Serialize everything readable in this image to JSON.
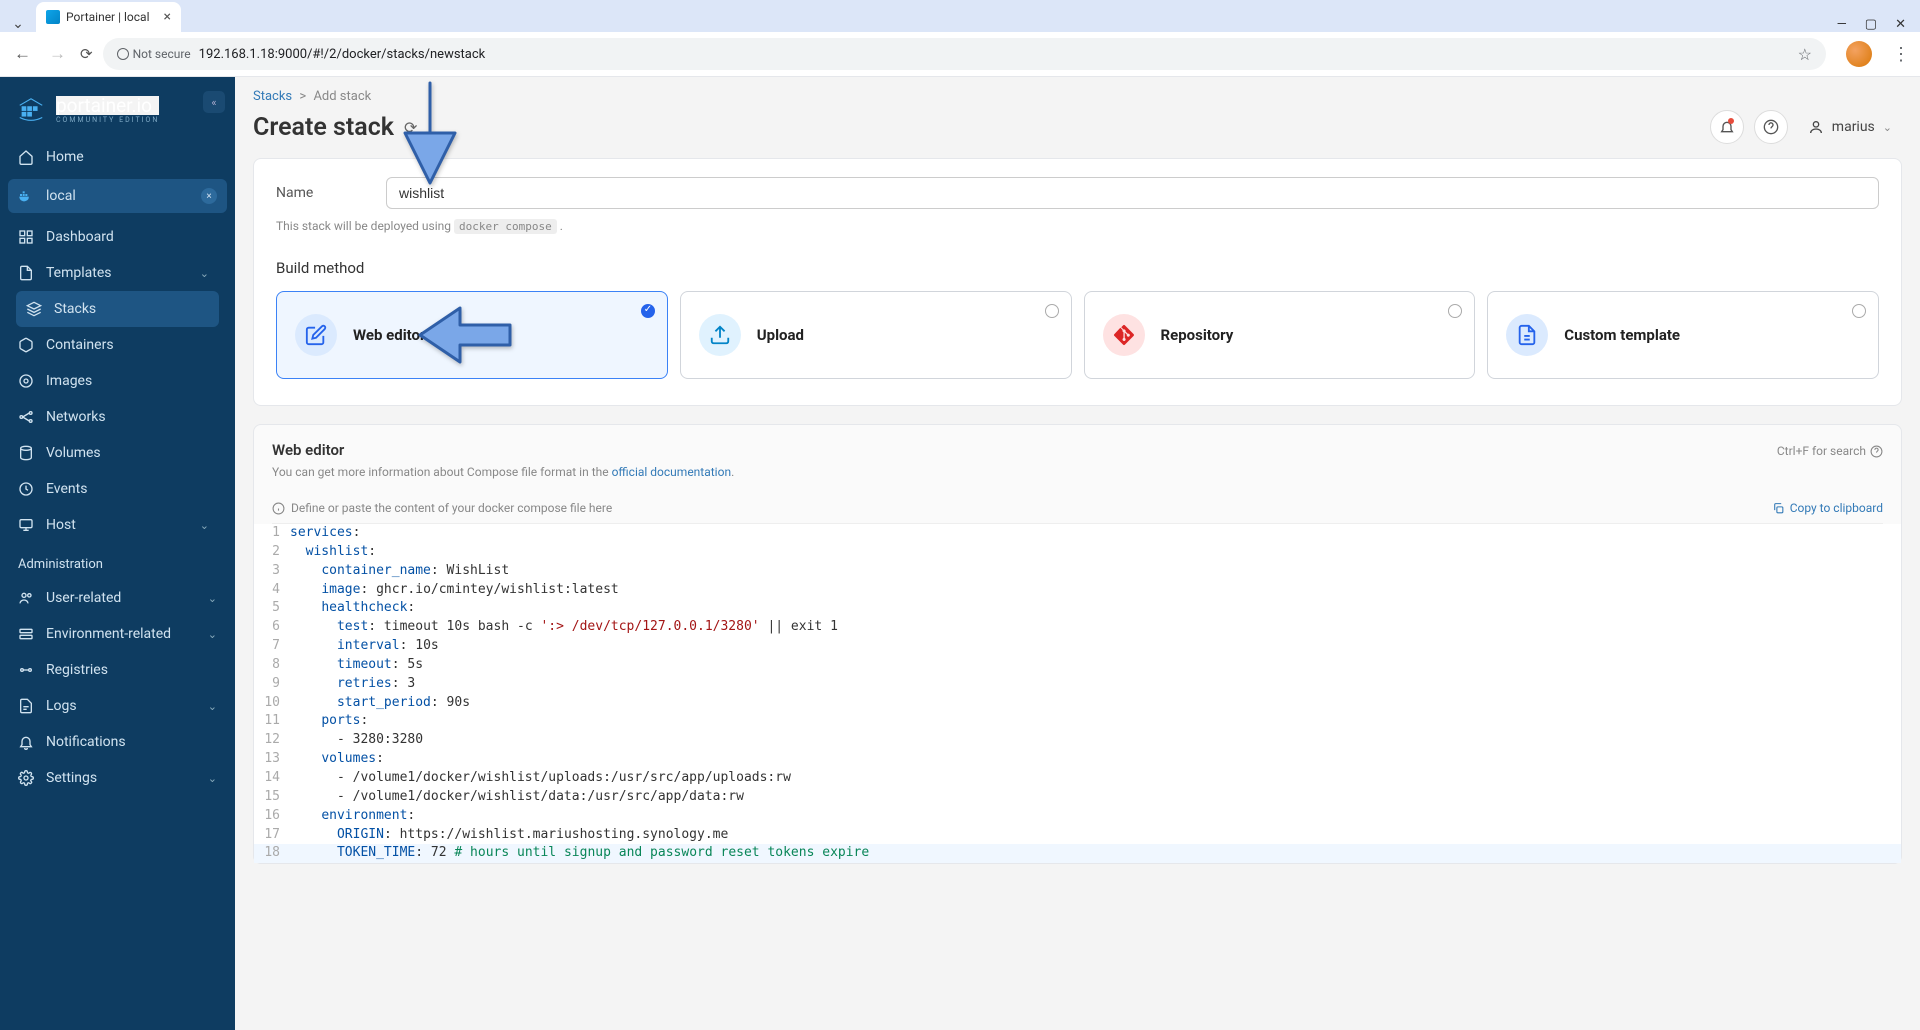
{
  "browser": {
    "tab_title": "Portainer | local",
    "url": "192.168.1.18:9000/#!/2/docker/stacks/newstack",
    "security_label": "Not secure"
  },
  "sidebar": {
    "brand": "portainer.io",
    "brand_sub": "COMMUNITY EDITION",
    "home": "Home",
    "env_name": "local",
    "items": {
      "dashboard": "Dashboard",
      "templates": "Templates",
      "stacks": "Stacks",
      "containers": "Containers",
      "images": "Images",
      "networks": "Networks",
      "volumes": "Volumes",
      "events": "Events",
      "host": "Host"
    },
    "admin_heading": "Administration",
    "admin": {
      "user_related": "User-related",
      "env_related": "Environment-related",
      "registries": "Registries",
      "logs": "Logs",
      "notifications": "Notifications",
      "settings": "Settings"
    }
  },
  "header": {
    "breadcrumb_root": "Stacks",
    "breadcrumb_sep": ">",
    "breadcrumb_leaf": "Add stack",
    "title": "Create stack",
    "username": "marius"
  },
  "form": {
    "name_label": "Name",
    "name_value": "wishlist",
    "helper_prefix": "This stack will be deployed using ",
    "helper_code": "docker compose",
    "build_method_label": "Build method",
    "methods": {
      "web_editor": "Web editor",
      "upload": "Upload",
      "repository": "Repository",
      "custom": "Custom template"
    }
  },
  "editor": {
    "title": "Web editor",
    "search_hint": "Ctrl+F for search",
    "sub_prefix": "You can get more information about Compose file format in the ",
    "sub_link": "official documentation",
    "placeholder_hint": "Define or paste the content of your docker compose file here",
    "copy_label": "Copy to clipboard",
    "code_lines": [
      "services:",
      "  wishlist:",
      "    container_name: WishList",
      "    image: ghcr.io/cmintey/wishlist:latest",
      "    healthcheck:",
      "      test: timeout 10s bash -c ':> /dev/tcp/127.0.0.1/3280' || exit 1",
      "      interval: 10s",
      "      timeout: 5s",
      "      retries: 3",
      "      start_period: 90s",
      "    ports:",
      "      - 3280:3280",
      "    volumes:",
      "      - /volume1/docker/wishlist/uploads:/usr/src/app/uploads:rw",
      "      - /volume1/docker/wishlist/data:/usr/src/app/data:rw",
      "    environment:",
      "      ORIGIN: https://wishlist.mariushosting.synology.me",
      "      TOKEN_TIME: 72 # hours until signup and password reset tokens expire"
    ]
  }
}
